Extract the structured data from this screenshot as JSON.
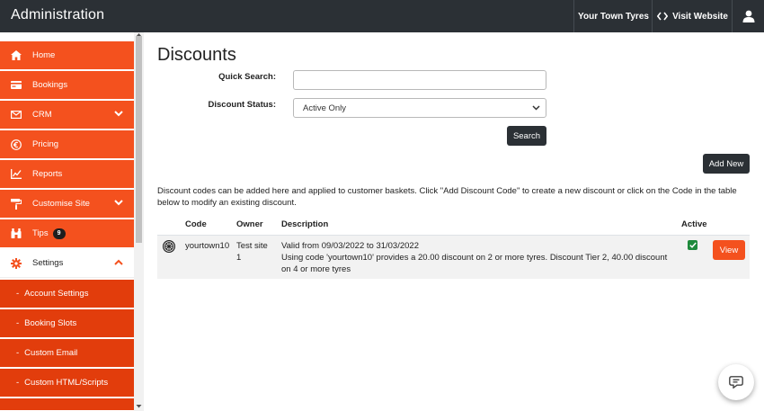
{
  "header": {
    "title": "Administration",
    "site_label": "Your Town Tyres",
    "visit_label": "Visit Website",
    "visit_icon": "code-icon",
    "user_icon": "user-icon"
  },
  "sidebar": {
    "items": [
      {
        "label": "Home",
        "icon": "home-icon"
      },
      {
        "label": "Bookings",
        "icon": "card-icon"
      },
      {
        "label": "CRM",
        "icon": "envelope-icon"
      },
      {
        "label": "Pricing",
        "icon": "euro-icon"
      },
      {
        "label": "Reports",
        "icon": "chart-icon"
      },
      {
        "label": "Customise Site",
        "icon": "paint-roller-icon"
      },
      {
        "label": "Tips",
        "icon": "binoculars-icon",
        "badge": "9"
      },
      {
        "label": "Settings",
        "icon": "gear-icon"
      }
    ],
    "sub_items": [
      {
        "label": "Account Settings"
      },
      {
        "label": "Booking Slots"
      },
      {
        "label": "Custom Email"
      },
      {
        "label": "Custom HTML/Scripts"
      }
    ]
  },
  "main": {
    "title": "Discounts",
    "quick_search_label": "Quick Search:",
    "quick_search_value": "",
    "status_label": "Discount Status:",
    "status_value": "Active Only",
    "search_button": "Search",
    "add_button": "Add New",
    "intro": "Discount codes can be added here and applied to customer baskets. Click \"Add Discount Code\" to create a new discount or click on the Code in the table below to modify an existing discount."
  },
  "table": {
    "headers": {
      "code": "Code",
      "owner": "Owner",
      "description": "Description",
      "active": "Active"
    },
    "rows": [
      {
        "icon": "tyre-icon",
        "code": "yourtown10",
        "owner": "Test site 1",
        "desc_line1": "Valid from 09/03/2022 to 31/03/2022",
        "desc_line2": "Using code 'yourtown10' provides a 20.00 discount on 2 or more tyres. Discount Tier 2, 40.00 discount on 4 or more tyres",
        "active": true,
        "view_label": "View"
      }
    ]
  },
  "colors": {
    "accent": "#f4511e",
    "accent_dark": "#e23d0c",
    "header_bg": "#2b3035",
    "active_check": "#1e8a3c"
  }
}
